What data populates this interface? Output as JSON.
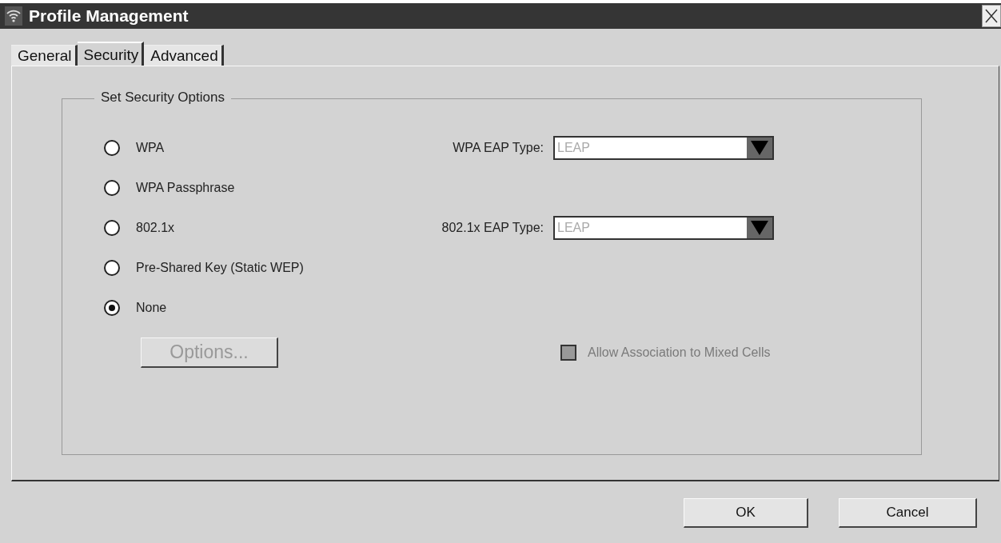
{
  "window": {
    "title": "Profile Management"
  },
  "tabs": [
    {
      "label": "General",
      "selected": false
    },
    {
      "label": "Security",
      "selected": true
    },
    {
      "label": "Advanced",
      "selected": false
    }
  ],
  "group": {
    "title": "Set Security Options",
    "options": [
      {
        "label": "WPA",
        "selected": false,
        "eap_type": {
          "label": "WPA EAP Type:",
          "value": "LEAP",
          "disabled": true
        }
      },
      {
        "label": "WPA Passphrase",
        "selected": false
      },
      {
        "label": "802.1x",
        "selected": false,
        "eap_type": {
          "label": "802.1x EAP Type:",
          "value": "LEAP",
          "disabled": true
        }
      },
      {
        "label": "Pre-Shared Key (Static WEP)",
        "selected": false
      },
      {
        "label": "None",
        "selected": true
      }
    ],
    "options_button": {
      "label": "Options...",
      "disabled": true
    },
    "mixed_cells": {
      "label": "Allow Association to Mixed Cells",
      "checked": false,
      "disabled": true
    }
  },
  "buttons": [
    {
      "label": "OK"
    },
    {
      "label": "Cancel"
    }
  ]
}
